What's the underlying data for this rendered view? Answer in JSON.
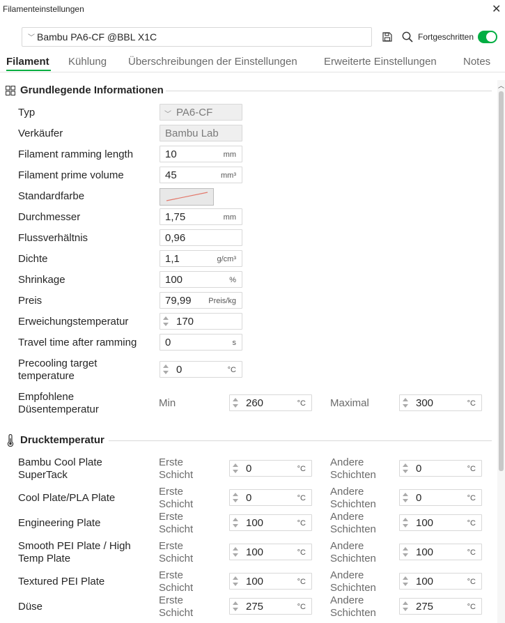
{
  "window": {
    "title": "Filamenteinstellungen"
  },
  "toolbar": {
    "preset": "Bambu PA6-CF @BBL X1C",
    "advanced_label": "Fortgeschritten",
    "advanced_on": true
  },
  "tabs": [
    "Filament",
    "Kühlung",
    "Überschreibungen der Einstellungen",
    "Erweiterte Einstellungen",
    "Notes"
  ],
  "basic": {
    "title": "Grundlegende Informationen",
    "rows": [
      {
        "label": "Typ",
        "value": "PA6-CF",
        "unit": ""
      },
      {
        "label": "Verkäufer",
        "value": "Bambu Lab",
        "unit": ""
      },
      {
        "label": "Filament ramming length",
        "value": "10",
        "unit": "mm"
      },
      {
        "label": "Filament prime volume",
        "value": "45",
        "unit": "mm³"
      },
      {
        "label": "Standardfarbe",
        "value": "",
        "unit": ""
      },
      {
        "label": "Durchmesser",
        "value": "1,75",
        "unit": "mm"
      },
      {
        "label": "Flussverhältnis",
        "value": "0,96",
        "unit": ""
      },
      {
        "label": "Dichte",
        "value": "1,1",
        "unit": "g/cm³"
      },
      {
        "label": "Shrinkage",
        "value": "100",
        "unit": "%"
      },
      {
        "label": "Preis",
        "value": "79,99",
        "unit": "Preis/kg"
      },
      {
        "label": "Erweichungstemperatur",
        "value": "170",
        "unit": ""
      },
      {
        "label": "Travel time after ramming",
        "value": "0",
        "unit": "s"
      },
      {
        "label_line1": "Precooling target",
        "label_line2": "temperature",
        "value": "0",
        "unit": "°C"
      }
    ],
    "nozzle": {
      "label_line1": "Empfohlene",
      "label_line2": "Düsentemperatur",
      "min_label": "Min",
      "min_value": "260",
      "max_label": "Maximal",
      "max_value": "300",
      "unit": "°C"
    }
  },
  "print_temp": {
    "title": "Drucktemperatur",
    "first_line1": "Erste",
    "first_line2": "Schicht",
    "other_line1": "Andere",
    "other_line2": "Schichten",
    "unit": "°C",
    "plates": [
      {
        "label_line1": "Bambu Cool Plate",
        "label_line2": "SuperTack",
        "first": "0",
        "other": "0"
      },
      {
        "label_line1": "Cool Plate/PLA Plate",
        "label_line2": "",
        "first": "0",
        "other": "0"
      },
      {
        "label_line1": "Engineering Plate",
        "label_line2": "",
        "first": "100",
        "other": "100"
      },
      {
        "label_line1": "Smooth PEI Plate / High",
        "label_line2": "Temp Plate",
        "first": "100",
        "other": "100"
      },
      {
        "label_line1": "Textured PEI Plate",
        "label_line2": "",
        "first": "100",
        "other": "100"
      },
      {
        "label_line1": "Düse",
        "label_line2": "",
        "first": "275",
        "other": "275"
      }
    ]
  },
  "colors": {
    "accent": "#00ae42",
    "swatch_line": "#e3776a"
  }
}
